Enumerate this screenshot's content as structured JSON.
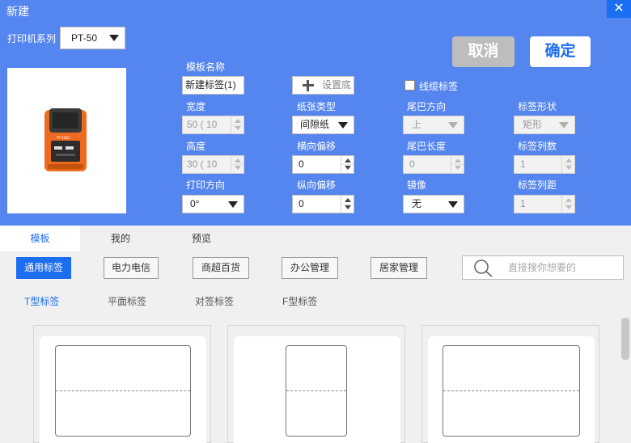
{
  "window": {
    "title": "新建",
    "close": "✕"
  },
  "printer": {
    "label": "打印机系列",
    "value": "PT-50"
  },
  "actions": {
    "cancel": "取消",
    "ok": "确定"
  },
  "form": {
    "template_name_label": "模板名称",
    "template_name_value": "新建标签(1)",
    "set_bg_label": "设置底",
    "cable_label": "线缆标签",
    "width_label": "宽度",
    "width_value": "50 ( 10",
    "paper_type_label": "纸张类型",
    "paper_type_value": "间隙纸",
    "tail_dir_label": "尾巴方向",
    "tail_dir_value": "上",
    "shape_label": "标签形状",
    "shape_value": "矩形",
    "height_label": "高度",
    "height_value": "30 ( 10",
    "h_offset_label": "横向偏移",
    "h_offset_value": "0",
    "tail_len_label": "尾巴长度",
    "tail_len_value": "0",
    "cols_label": "标签列数",
    "cols_value": "1",
    "print_dir_label": "打印方向",
    "print_dir_value": "0°",
    "v_offset_label": "纵向偏移",
    "v_offset_value": "0",
    "mirror_label": "镜像",
    "mirror_value": "无",
    "col_gap_label": "标签列距",
    "col_gap_value": "1"
  },
  "tabs": [
    "模板",
    "我的",
    "预览"
  ],
  "categories": [
    "通用标签",
    "电力电信",
    "商超百货",
    "办公管理",
    "居家管理"
  ],
  "search": {
    "placeholder": "直接搜你想要的"
  },
  "subtabs": [
    "T型标签",
    "平面标签",
    "对签标签",
    "F型标签"
  ],
  "device": {
    "brand": "PT-50DC"
  },
  "colors": {
    "header": "#5585ee",
    "accent": "#1d6df0",
    "close_bg": "#1a6ef2"
  }
}
